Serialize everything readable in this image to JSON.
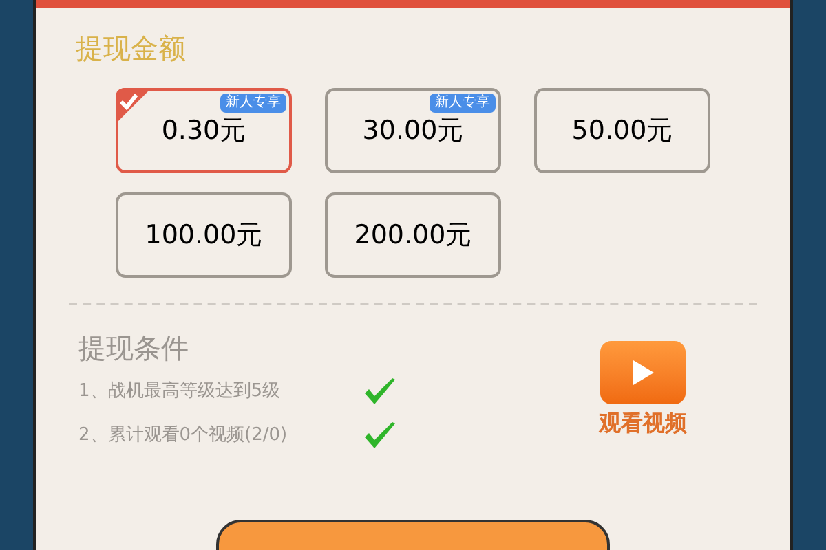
{
  "amount_section": {
    "title": "提现金额",
    "options": [
      {
        "amount": "0.30元",
        "badge": "新人专享",
        "selected": true
      },
      {
        "amount": "30.00元",
        "badge": "新人专享",
        "selected": false
      },
      {
        "amount": "50.00元",
        "selected": false
      },
      {
        "amount": "100.00元",
        "selected": false
      },
      {
        "amount": "200.00元",
        "selected": false
      }
    ]
  },
  "conditions_section": {
    "title": "提现条件",
    "conditions": [
      {
        "text": "1、战机最高等级达到5级",
        "met": true
      },
      {
        "text": "2、累计观看0个视频(2/0)",
        "met": true
      }
    ],
    "video_button": {
      "label": "观看视频"
    }
  }
}
